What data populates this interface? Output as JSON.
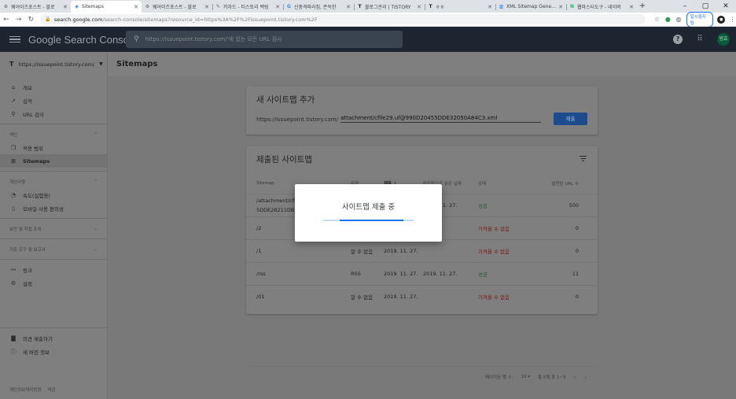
{
  "browser": {
    "tabs": [
      {
        "title": "웨어이즈포스트 - 블로",
        "favicon": "gear",
        "color": "#5f6368"
      },
      {
        "title": "Sitemaps",
        "favicon": "gsc",
        "color": "#1a73e8",
        "active": true
      },
      {
        "title": "웨어이즈포스트 - 블로",
        "favicon": "gear",
        "color": "#5f6368"
      },
      {
        "title": "키자드 - 티스토리 백링",
        "favicon": "pen",
        "color": "#5f6368"
      },
      {
        "title": "신중격파라집, 존득한",
        "favicon": "G",
        "color": "#4285f4"
      },
      {
        "title": "블로그관리 | TISTORY",
        "favicon": "T",
        "color": "#202124"
      },
      {
        "title": "ㅎㅎ",
        "favicon": "T",
        "color": "#202124"
      },
      {
        "title": "XML Sitemap Generat",
        "favicon": "chart",
        "color": "#1a73e8"
      },
      {
        "title": "웹마스터도구 - 네이버",
        "favicon": "N",
        "color": "#03c75a"
      }
    ],
    "new_tab": "+",
    "window_controls": [
      "–",
      "▢",
      "✕"
    ],
    "url_host": "search.google.com",
    "url_path": "/search-console/sitemaps?resource_id=https%3A%2F%2Fissuepoint.tistory.com%2F",
    "pause_label": "일시중지됨"
  },
  "header": {
    "brand": "Google Search Console",
    "search_placeholder": "https://issuepoint.tistory.com/'에 있는 모든 URL 검사",
    "account_initial": "범효"
  },
  "property": {
    "label": "https://issuepoint.tistory.com/",
    "page_title": "Sitemaps"
  },
  "sidebar": {
    "items_top": [
      {
        "label": "개요",
        "icon": "home-icon",
        "glyph": "⌂"
      },
      {
        "label": "실적",
        "icon": "trending-up-icon",
        "glyph": "↗"
      },
      {
        "label": "URL 검사",
        "icon": "search-icon",
        "glyph": "⚲"
      }
    ],
    "section_index": "색인",
    "items_index": [
      {
        "label": "적용 범위",
        "icon": "copy-icon",
        "glyph": "❐"
      },
      {
        "label": "Sitemaps",
        "icon": "sitemap-icon",
        "glyph": "⊞",
        "active": true
      }
    ],
    "section_enh": "개선사항",
    "items_enh": [
      {
        "label": "속도(실험용)",
        "icon": "speed-icon",
        "glyph": "◔"
      },
      {
        "label": "모바일 사용 편의성",
        "icon": "phone-icon",
        "glyph": "▯"
      }
    ],
    "section_security": "보안 및 직접 조치",
    "section_legacy": "기존 도구 및 보고서",
    "items_misc": [
      {
        "label": "링크",
        "icon": "links-icon",
        "glyph": "⚯"
      },
      {
        "label": "설정",
        "icon": "settings-icon",
        "glyph": "⚙"
      }
    ],
    "items_bottom": [
      {
        "label": "의견 제출하기",
        "icon": "feedback-icon",
        "glyph": "▇"
      },
      {
        "label": "새 버전 정보",
        "icon": "info-icon",
        "glyph": "ⓘ"
      }
    ],
    "footer_privacy": "개인정보처리방침",
    "footer_terms": "약관"
  },
  "add_card": {
    "title": "새 사이트맵 추가",
    "prefix": "https://issuepoint.tistory.com/",
    "input_value": "attachment/cfile29.uf@990D20455DDE32050A84C3.xml",
    "submit_label": "제출"
  },
  "submitted_card": {
    "title": "제출된 사이트맵",
    "headers": {
      "sitemap": "Sitemap",
      "type": "유형",
      "submitted": "제출 ↓",
      "last_read": "마지막으로 읽은 날짜",
      "status": "상태",
      "urls": "발견된 URL 수"
    },
    "rows": [
      {
        "sitemap": "/attachment/cfil",
        "sitemap2": "5DDE28211DBF",
        "type": "",
        "submitted": "",
        "last_read": "2019. 11. 27.",
        "status": "성공",
        "status_kind": "ok",
        "urls": "500"
      },
      {
        "sitemap": "/2",
        "type": "",
        "submitted": "",
        "last_read": "",
        "status": "가져올 수 없음",
        "status_kind": "err",
        "urls": "0"
      },
      {
        "sitemap": "/1",
        "type": "알 수 없음",
        "submitted": "2019. 11. 27.",
        "last_read": "",
        "status": "가져올 수 없음",
        "status_kind": "err",
        "urls": "0"
      },
      {
        "sitemap": "/rss",
        "type": "RSS",
        "submitted": "2019. 11. 27.",
        "last_read": "2019. 11. 27.",
        "status": "성공",
        "status_kind": "ok",
        "urls": "11"
      },
      {
        "sitemap": "/01",
        "type": "알 수 없음",
        "submitted": "2019. 11. 27.",
        "last_read": "",
        "status": "가져올 수 없음",
        "status_kind": "err",
        "urls": "0"
      }
    ],
    "pager": {
      "rows_per_page_label": "페이지당 행 수:",
      "rows_per_page_value": "10",
      "range": "총 5행 중 1~5"
    }
  },
  "modal": {
    "title": "사이트맵 제출 중",
    "progress_fraction": 0.7
  }
}
